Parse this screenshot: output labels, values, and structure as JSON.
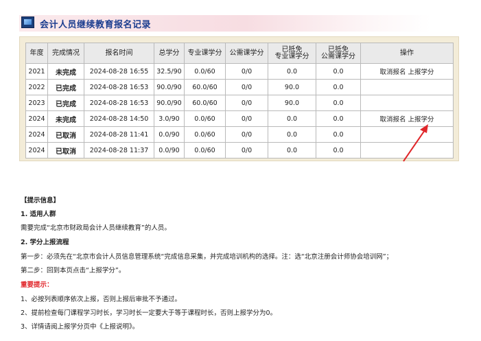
{
  "header": {
    "title": "会计人员继续教育报名记录"
  },
  "table": {
    "columns": [
      "年度",
      "完成情况",
      "报名时间",
      "总学分",
      "专业课学分",
      "公需课学分",
      "已抵免\n专业课学分",
      "已抵免\n公需课学分",
      "操作"
    ],
    "rows": [
      {
        "year": "2021",
        "status": "未完成",
        "time": "2024-08-28 16:55",
        "total": "32.5/90",
        "pro": "0.0/60",
        "pub": "0/0",
        "pro_exempt": "0.0",
        "pub_exempt": "0.0",
        "cancel": "取消报名",
        "report": "上报学分"
      },
      {
        "year": "2022",
        "status": "已完成",
        "time": "2024-08-28 16:53",
        "total": "90.0/90",
        "pro": "60.0/60",
        "pub": "0/0",
        "pro_exempt": "90.0",
        "pub_exempt": "0.0",
        "cancel": "",
        "report": ""
      },
      {
        "year": "2023",
        "status": "已完成",
        "time": "2024-08-28 16:53",
        "total": "90.0/90",
        "pro": "60.0/60",
        "pub": "0/0",
        "pro_exempt": "90.0",
        "pub_exempt": "0.0",
        "cancel": "",
        "report": ""
      },
      {
        "year": "2024",
        "status": "未完成",
        "time": "2024-08-28 14:50",
        "total": "3.0/90",
        "pro": "0.0/60",
        "pub": "0/0",
        "pro_exempt": "0.0",
        "pub_exempt": "0.0",
        "cancel": "取消报名",
        "report": "上报学分"
      },
      {
        "year": "2024",
        "status": "已取消",
        "time": "2024-08-28 11:41",
        "total": "0.0/90",
        "pro": "0.0/60",
        "pub": "0/0",
        "pro_exempt": "0.0",
        "pub_exempt": "0.0",
        "cancel": "",
        "report": ""
      },
      {
        "year": "2024",
        "status": "已取消",
        "time": "2024-08-28 11:37",
        "total": "0.0/90",
        "pro": "0.0/60",
        "pub": "0/0",
        "pro_exempt": "0.0",
        "pub_exempt": "0.0",
        "cancel": "",
        "report": ""
      }
    ]
  },
  "info": {
    "heading": "【提示信息】",
    "section1_title": "1. 适用人群",
    "section1_text": "需要完成“北京市财政局会计人员继续教育”的人员。",
    "section2_title": "2. 学分上报流程",
    "step1": "第一步：必须先在“北京市会计人员信息管理系统“完成信息采集，并完成培训机构的选择。注：选“北京注册会计师协会培训网”；",
    "step2": "第二步：回到本页点击“上报学分”。",
    "important_title": "重要提示：",
    "tip1": "1、必按列表顺序依次上报，否则上报后审批不予通过。",
    "tip2": "2、提前检查每门课程学习时长，学习时长一定要大于等于课程时长，否则上报学分为0。",
    "tip3": "3、详情请阅上报学分页中《上报说明》。"
  },
  "colors": {
    "accent_red": "#e0262a",
    "title_blue": "#1b3d8f",
    "panel_bg": "#f3ecd8"
  }
}
